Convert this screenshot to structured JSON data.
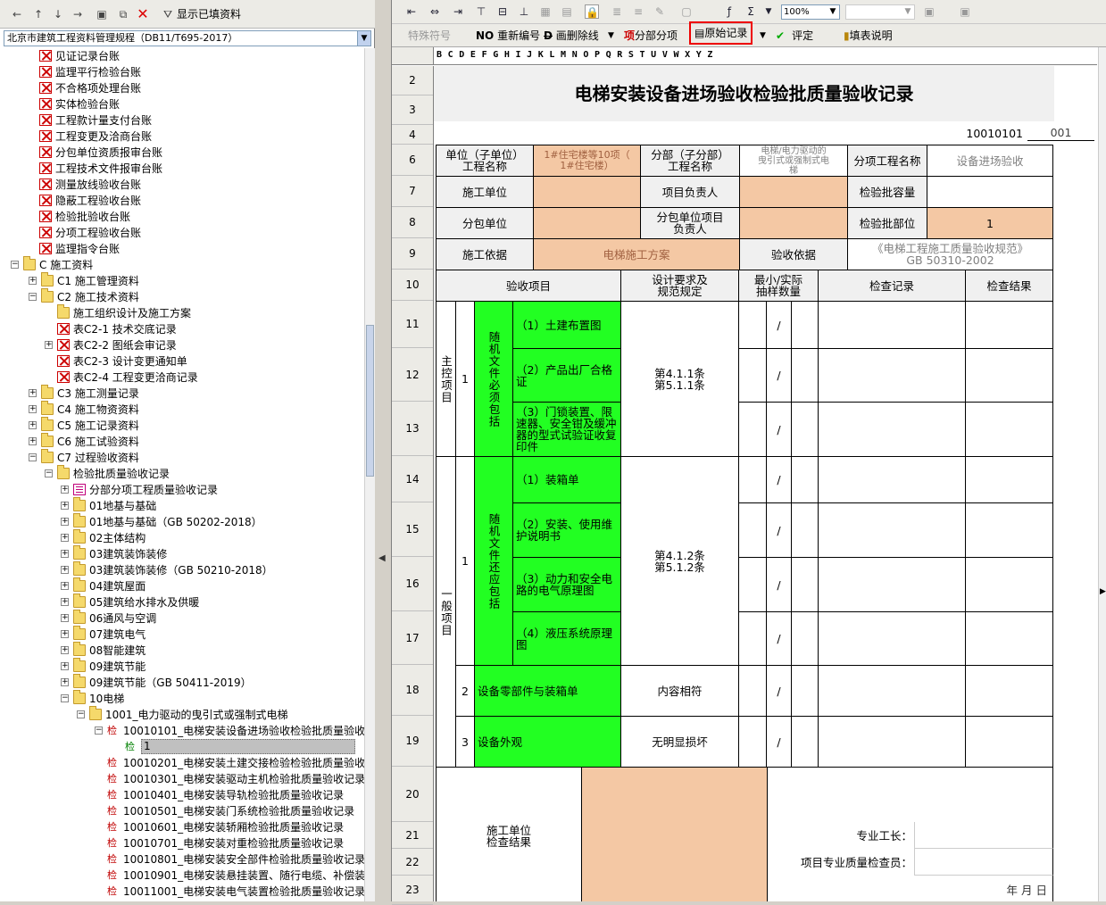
{
  "left_toolbar": {
    "show_filled_label": "显示已填资料",
    "std_select": "北京市建筑工程资料管理规程（DB11/T695-2017）"
  },
  "tree": [
    {
      "label": "见证记录台账",
      "icon": "red-x"
    },
    {
      "label": "监理平行检验台账",
      "icon": "red-x"
    },
    {
      "label": "不合格项处理台账",
      "icon": "red-x"
    },
    {
      "label": "实体检验台账",
      "icon": "red-x"
    },
    {
      "label": "工程款计量支付台账",
      "icon": "red-x"
    },
    {
      "label": "工程变更及洽商台账",
      "icon": "red-x"
    },
    {
      "label": "分包单位资质报审台账",
      "icon": "red-x"
    },
    {
      "label": "工程技术文件报审台账",
      "icon": "red-x"
    },
    {
      "label": "测量放线验收台账",
      "icon": "red-x"
    },
    {
      "label": "隐蔽工程验收台账",
      "icon": "red-x"
    },
    {
      "label": "检验批验收台账",
      "icon": "red-x"
    },
    {
      "label": "分项工程验收台账",
      "icon": "red-x"
    },
    {
      "label": "监理指令台账",
      "icon": "red-x"
    },
    {
      "label": "C 施工资料",
      "icon": "folder"
    },
    {
      "label": "C1 施工管理资料",
      "icon": "folder"
    },
    {
      "label": "C2 施工技术资料",
      "icon": "folder"
    },
    {
      "label": "施工组织设计及施工方案",
      "icon": "folder"
    },
    {
      "label": "表C2-1 技术交底记录",
      "icon": "red-x"
    },
    {
      "label": "表C2-2 图纸会审记录",
      "icon": "red-x"
    },
    {
      "label": "表C2-3 设计变更通知单",
      "icon": "red-x"
    },
    {
      "label": "表C2-4 工程变更洽商记录",
      "icon": "red-x"
    },
    {
      "label": "C3 施工测量记录",
      "icon": "folder"
    },
    {
      "label": "C4 施工物资资料",
      "icon": "folder"
    },
    {
      "label": "C5 施工记录资料",
      "icon": "folder"
    },
    {
      "label": "C6 施工试验资料",
      "icon": "folder"
    },
    {
      "label": "C7 过程验收资料",
      "icon": "folder"
    },
    {
      "label": "检验批质量验收记录",
      "icon": "folder"
    },
    {
      "label": "分部分项工程质量验收记录",
      "icon": "report"
    },
    {
      "label": "01地基与基础",
      "icon": "folder"
    },
    {
      "label": "01地基与基础（GB 50202-2018）",
      "icon": "folder"
    },
    {
      "label": "02主体结构",
      "icon": "folder"
    },
    {
      "label": "03建筑装饰装修",
      "icon": "folder"
    },
    {
      "label": "03建筑装饰装修（GB 50210-2018）",
      "icon": "folder"
    },
    {
      "label": "04建筑屋面",
      "icon": "folder"
    },
    {
      "label": "05建筑给水排水及供暖",
      "icon": "folder"
    },
    {
      "label": "06通风与空调",
      "icon": "folder"
    },
    {
      "label": "07建筑电气",
      "icon": "folder"
    },
    {
      "label": "08智能建筑",
      "icon": "folder"
    },
    {
      "label": "09建筑节能",
      "icon": "folder"
    },
    {
      "label": "09建筑节能（GB 50411-2019）",
      "icon": "folder"
    },
    {
      "label": "10电梯",
      "icon": "folder"
    },
    {
      "label": "1001_电力驱动的曳引式或强制式电梯",
      "icon": "folder"
    },
    {
      "label": "10010101_电梯安装设备进场验收检验批质量验收",
      "icon": "jian"
    },
    {
      "label": "1",
      "icon": "jian-green"
    },
    {
      "label": "10010201_电梯安装土建交接检验检验批质量验收",
      "icon": "jian"
    },
    {
      "label": "10010301_电梯安装驱动主机检验批质量验收记录",
      "icon": "jian"
    },
    {
      "label": "10010401_电梯安装导轨检验批质量验收记录",
      "icon": "jian"
    },
    {
      "label": "10010501_电梯安装门系统检验批质量验收记录",
      "icon": "jian"
    },
    {
      "label": "10010601_电梯安装轿厢检验批质量验收记录",
      "icon": "jian"
    },
    {
      "label": "10010701_电梯安装对重检验批质量验收记录",
      "icon": "jian"
    },
    {
      "label": "10010801_电梯安装安全部件检验批质量验收记录",
      "icon": "jian"
    },
    {
      "label": "10010901_电梯安装悬挂装置、随行电缆、补偿装",
      "icon": "jian"
    },
    {
      "label": "10011001_电梯安装电气装置检验批质量验收记录",
      "icon": "jian"
    }
  ],
  "jian_glyph": "检",
  "right_toolbar": {
    "zoom": "100%",
    "special_symbol": "特殊符号",
    "renumber": "重新编号",
    "draw_del_line": "画删除线",
    "sub_item": "分部分项",
    "original_record": "原始记录",
    "evaluate": "评定",
    "fill_guide": "填表说明"
  },
  "column_letters": "B C D E F G H I J K L M N O P Q R S T U V W X Y Z",
  "row_numbers": [
    "2",
    "3",
    "4",
    "6",
    "7",
    "8",
    "9",
    "10",
    "11",
    "12",
    "13",
    "14",
    "15",
    "16",
    "17",
    "18",
    "19",
    "20",
    "21",
    "22",
    "23"
  ],
  "form": {
    "title": "电梯安装设备进场验收检验批质量验收记录",
    "code": "10010101",
    "serial": "001",
    "unit_label": "单位（子单位）\n工程名称",
    "unit_value": "1#住宅楼等10项（\n1#住宅楼）",
    "subunit_label": "分部（子分部）\n工程名称",
    "subunit_value": "电梯/电力驱动的\n曳引式或强制式电\n梯",
    "subitem_label": "分项工程名称",
    "subitem_value": "设备进场验收",
    "contractor_label": "施工单位",
    "pm_label": "项目负责人",
    "batch_capacity_label": "检验批容量",
    "subcontractor_label": "分包单位",
    "sub_pm_label": "分包单位项目\n负责人",
    "batch_part_label": "检验批部位",
    "batch_part_value": "1",
    "basis_label": "施工依据",
    "basis_value": "电梯施工方案",
    "accept_basis_label": "验收依据",
    "accept_basis_value": "《电梯工程施工质量验收规范》\nGB 50310-2002",
    "col_items": "验收项目",
    "col_design": "设计要求及\n规范规定",
    "col_sample": "最小/实际\n抽样数量",
    "col_check": "检查记录",
    "col_result": "检查结果",
    "main_control": "主控项目",
    "general": "一般项目",
    "n1": "1",
    "n2": "2",
    "n3": "3",
    "main_group": "随机文件必须包括",
    "main_items": [
      "（1）土建布置图",
      "（2）产品出厂合格证",
      "（3）门锁装置、限速器、安全钳及缓冲器的型式试验证收复印件"
    ],
    "main_clause": "第4.1.1条\n第5.1.1条",
    "gen_group": "随机文件还应包括",
    "gen_items": [
      "（1）装箱单",
      "（2）安装、使用维护说明书",
      "（3）动力和安全电路的电气原理图",
      "（4）液压系统原理图"
    ],
    "gen_clause": "第4.1.2条\n第5.1.2条",
    "item2_label": "设备零部件与装箱单",
    "item2_req": "内容相符",
    "item3_label": "设备外观",
    "item3_req": "无明显损坏",
    "slash": "/",
    "check_result_label": "施工单位\n检查结果",
    "foreman_label": "专业工长：",
    "qc_label": "项目专业质量检查员：",
    "date_label": "年     月     日"
  }
}
